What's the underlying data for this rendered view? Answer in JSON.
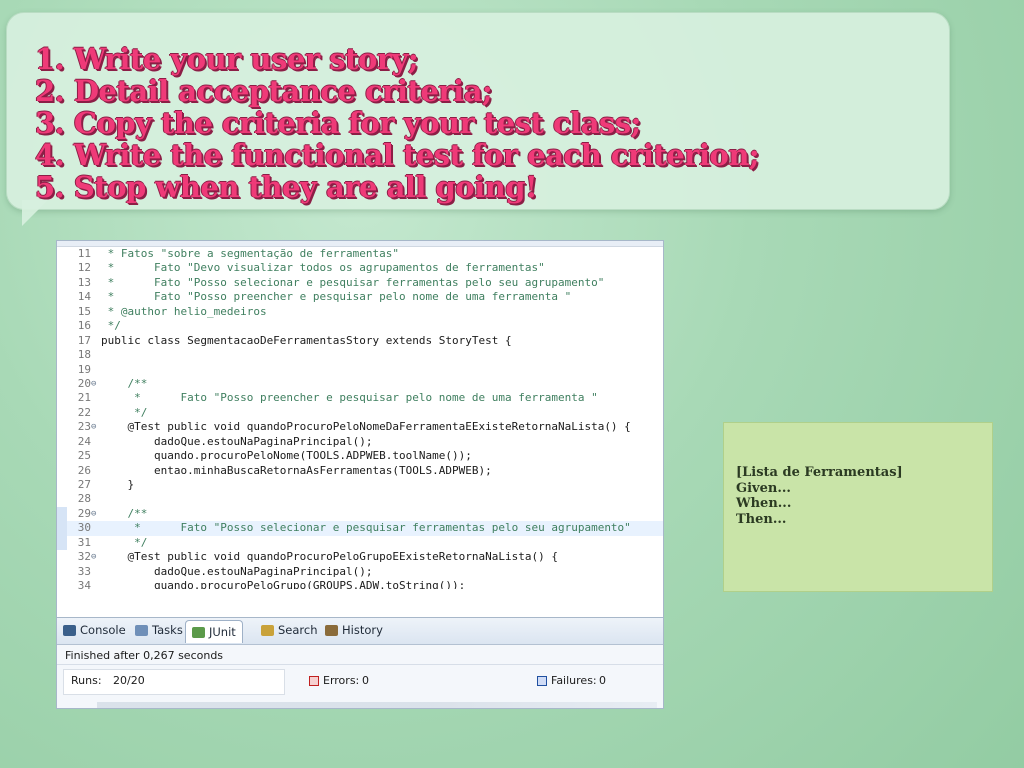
{
  "bubble": {
    "steps": [
      "1. Write your user story;",
      "2. Detail acceptance criteria;",
      "3. Copy the criteria for your test class;",
      "4. Write the functional test for each criterion;",
      "5. Stop when they are all going!"
    ]
  },
  "editor": {
    "lines": [
      {
        "num": "11",
        "text": " * Fatos \"sobre a segmentação de ferramentas\""
      },
      {
        "num": "12",
        "text": " *      Fato \"Devo visualizar todos os agrupamentos de ferramentas\""
      },
      {
        "num": "13",
        "text": " *      Fato \"Posso selecionar e pesquisar ferramentas pelo seu agrupamento\""
      },
      {
        "num": "14",
        "text": " *      Fato \"Posso preencher e pesquisar pelo nome de uma ferramenta \""
      },
      {
        "num": "15",
        "text": " * @author helio_medeiros"
      },
      {
        "num": "16",
        "text": " */"
      },
      {
        "num": "17",
        "text": "public class SegmentacaoDeFerramentasStory extends StoryTest {"
      },
      {
        "num": "18",
        "text": ""
      },
      {
        "num": "19",
        "text": ""
      },
      {
        "num": "20",
        "text": "    /**"
      },
      {
        "num": "21",
        "text": "     *      Fato \"Posso preencher e pesquisar pelo nome de uma ferramenta \""
      },
      {
        "num": "22",
        "text": "     */"
      },
      {
        "num": "23",
        "text": "    @Test public void quandoProcuroPeloNomeDaFerramentaEExisteRetornaNaLista() {"
      },
      {
        "num": "24",
        "text": "        dadoQue.estouNaPaginaPrincipal();"
      },
      {
        "num": "25",
        "text": "        quando.procuroPeloNome(TOOLS.ADPWEB.toolName());"
      },
      {
        "num": "26",
        "text": "        entao.minhaBuscaRetornaAsFerramentas(TOOLS.ADPWEB);"
      },
      {
        "num": "27",
        "text": "    }"
      },
      {
        "num": "28",
        "text": ""
      },
      {
        "num": "29",
        "text": "    /**"
      },
      {
        "num": "30",
        "text": "     *      Fato \"Posso selecionar e pesquisar ferramentas pelo seu agrupamento\""
      },
      {
        "num": "31",
        "text": "     */"
      },
      {
        "num": "32",
        "text": "    @Test public void quandoProcuroPeloGrupoEExisteRetornaNaLista() {"
      },
      {
        "num": "33",
        "text": "        dadoQue.estouNaPaginaPrincipal();"
      },
      {
        "num": "34",
        "text": "        quando.procuroPeloGrupo(GROUPS.ADW.toString());"
      }
    ]
  },
  "panel": {
    "tabs": [
      {
        "label": "Console",
        "icon": "console-icon"
      },
      {
        "label": "Tasks",
        "icon": "tasks-icon"
      },
      {
        "label": "JUnit",
        "icon": "junit-icon"
      },
      {
        "label": "Search",
        "icon": "search-icon"
      },
      {
        "label": "History",
        "icon": "history-icon"
      }
    ],
    "status": "Finished after 0,267 seconds",
    "runs_label": "Runs:",
    "runs_value": "20/20",
    "errors_label": "Errors:",
    "errors_value": "0",
    "failures_label": "Failures:",
    "failures_value": "0"
  },
  "note": {
    "lines": [
      "[Lista de Ferramentas]",
      "Given...",
      "When...",
      "Then..."
    ]
  },
  "colors": {
    "background": "#9fd3ae",
    "bubble": "#d7f0de",
    "step_text": "#ef3a78",
    "note": "#c9e4a8"
  }
}
